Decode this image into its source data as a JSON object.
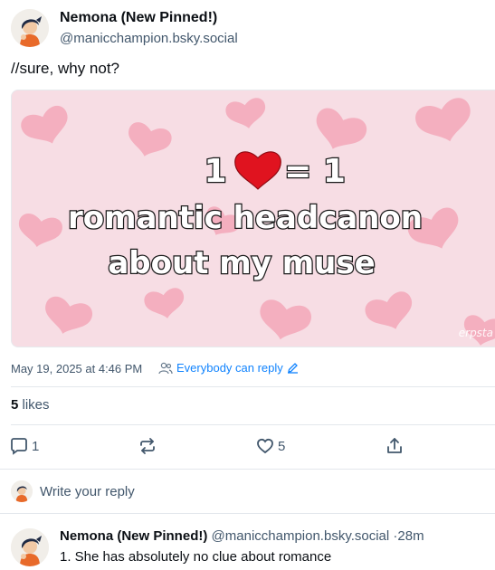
{
  "post": {
    "author_name": "Nemona (New Pinned!)",
    "author_handle": "@manicchampion.bsky.social",
    "text": "//sure, why not?",
    "image": {
      "line1_left": "1",
      "line1_right": "= 1",
      "line2": "romantic headcanon",
      "line3": "about my muse",
      "watermark": "erpsta"
    },
    "date": "May 19, 2025 at 4:46 PM",
    "reply_setting": "Everybody can reply",
    "likes_count": "5",
    "likes_label": "likes"
  },
  "actions": {
    "reply_count": "1",
    "like_count": "5"
  },
  "composer": {
    "placeholder": "Write your reply"
  },
  "reply": {
    "author_name": "Nemona (New Pinned!)",
    "author_handle": "@manicchampion.bsky.social",
    "separator": "·",
    "time": "28m",
    "text": "1. She has absolutely no clue about romance"
  },
  "colors": {
    "accent": "#1083fe",
    "muted": "#42576c",
    "image_bg": "#f7dde4",
    "heart_pink": "#f4a7b9",
    "heart_red": "#e0131f"
  }
}
